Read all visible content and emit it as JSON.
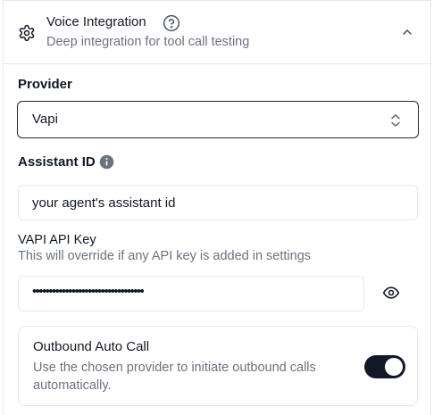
{
  "header": {
    "title": "Voice Integration",
    "subtitle": "Deep integration for tool call testing",
    "icons": [
      "gear-icon",
      "help-circle-icon",
      "chevron-up-icon"
    ]
  },
  "provider": {
    "label": "Provider",
    "value": "Vapi",
    "icon": "up-down-chevron-icon"
  },
  "assistant": {
    "label": "Assistant ID",
    "value": "your agent's assistant id",
    "icon": "info-icon"
  },
  "api_key": {
    "label": "VAPI API Key",
    "description": "This will override if any API key is added in settings",
    "value": "••••••••••••••••••••••••••••••••••",
    "icon": "eye-icon"
  },
  "outbound": {
    "title": "Outbound Auto Call",
    "description": "Use the chosen provider to initiate outbound calls automatically.",
    "enabled": true
  },
  "colors": {
    "text": "#111827",
    "muted": "#6b7280",
    "border": "#e5e7eb",
    "toggle_on": "#111827"
  }
}
